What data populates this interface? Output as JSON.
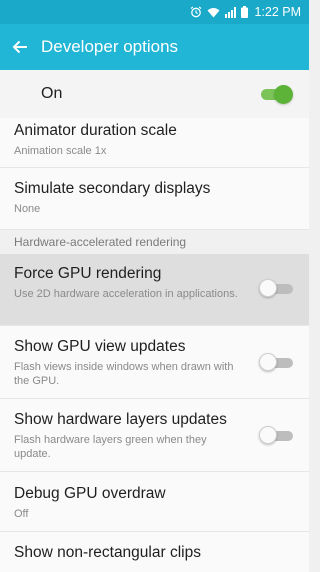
{
  "status_bar": {
    "time": "1:22 PM",
    "icons": [
      "alarm-icon",
      "wifi-icon",
      "signal-icon",
      "battery-icon"
    ],
    "color": "#1aa9c9"
  },
  "app_bar": {
    "title": "Developer options",
    "color": "#21b5d6"
  },
  "master_switch": {
    "label": "On",
    "checked": true,
    "accent": "#5cb338"
  },
  "items": [
    {
      "title": "Animator duration scale",
      "subtitle": "Animation scale 1x"
    },
    {
      "title": "Simulate secondary displays",
      "subtitle": "None"
    }
  ],
  "section": {
    "header": "Hardware-accelerated rendering",
    "items": [
      {
        "title": "Force GPU rendering",
        "subtitle": "Use 2D hardware acceleration in applications.",
        "checked": false
      },
      {
        "title": "Show GPU view updates",
        "subtitle": "Flash views inside windows when drawn with the GPU.",
        "checked": false
      },
      {
        "title": "Show hardware layers updates",
        "subtitle": "Flash hardware layers green when they update.",
        "checked": false
      },
      {
        "title": "Debug GPU overdraw",
        "subtitle": "Off"
      },
      {
        "title": "Show non-rectangular clips"
      }
    ]
  }
}
